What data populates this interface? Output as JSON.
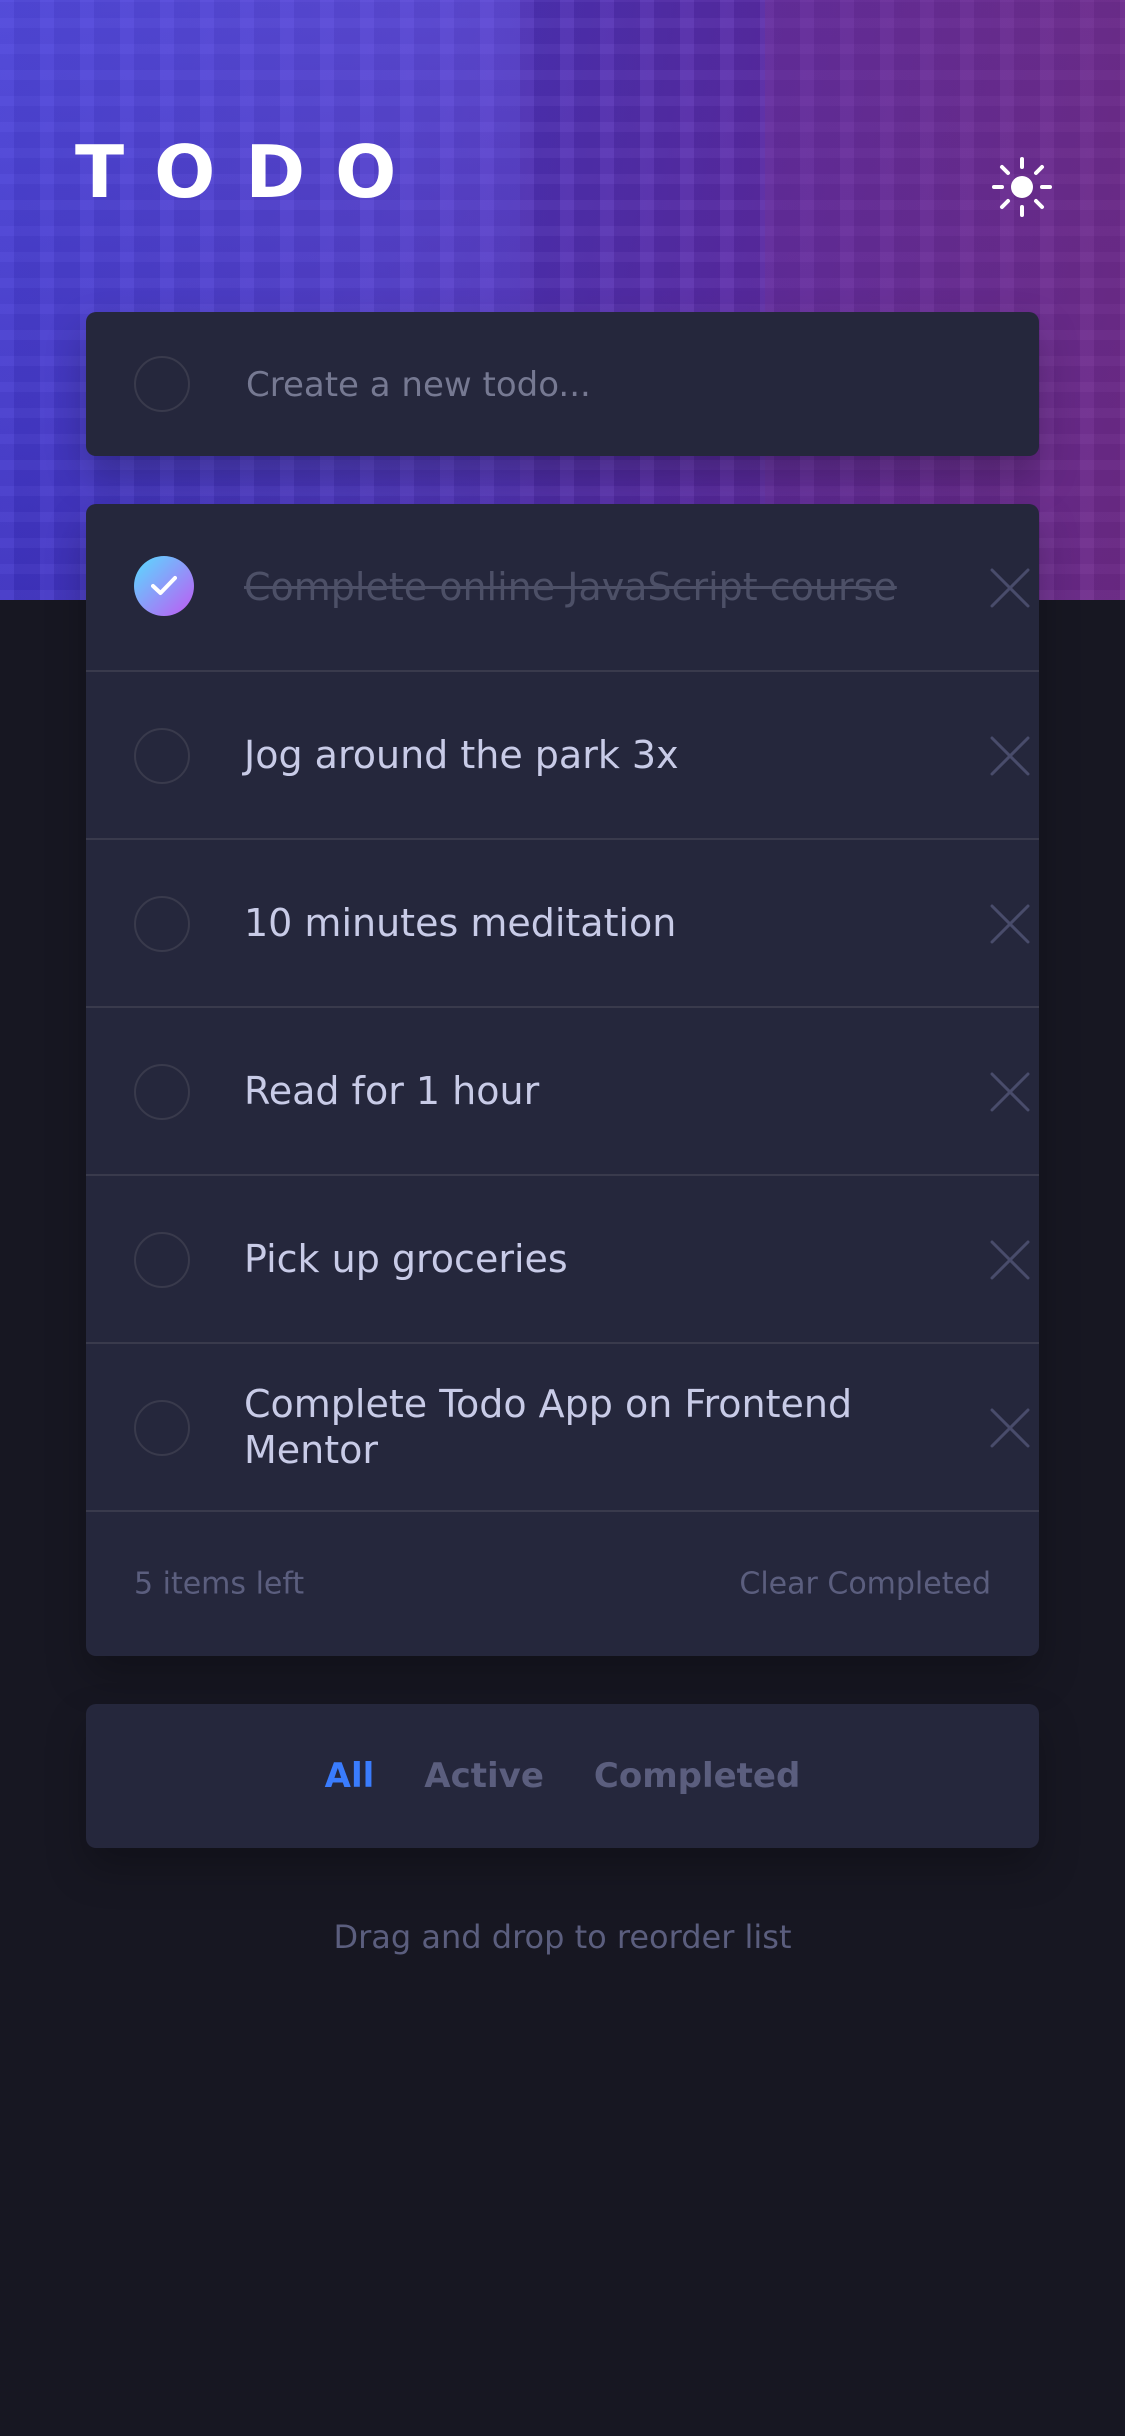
{
  "app": {
    "title": "TODO"
  },
  "header": {
    "theme_toggle_icon": "sun-icon"
  },
  "new_todo": {
    "placeholder": "Create a new todo...",
    "value": ""
  },
  "todos": [
    {
      "text": "Complete online JavaScript course",
      "completed": true
    },
    {
      "text": "Jog around the park 3x",
      "completed": false
    },
    {
      "text": "10 minutes meditation",
      "completed": false
    },
    {
      "text": "Read for 1 hour",
      "completed": false
    },
    {
      "text": "Pick up groceries",
      "completed": false
    },
    {
      "text": "Complete Todo App on Frontend Mentor",
      "completed": false
    }
  ],
  "list_footer": {
    "items_left": "5 items left",
    "clear_completed": "Clear Completed"
  },
  "filters": {
    "all": "All",
    "active": "Active",
    "completed": "Completed",
    "selected": "All"
  },
  "hint": "Drag and drop to reorder list",
  "colors": {
    "background": "#171722",
    "card": "#25273c",
    "accent": "#3a7cfd",
    "check_gradient_start": "#57ddff",
    "check_gradient_end": "#c058f3"
  }
}
